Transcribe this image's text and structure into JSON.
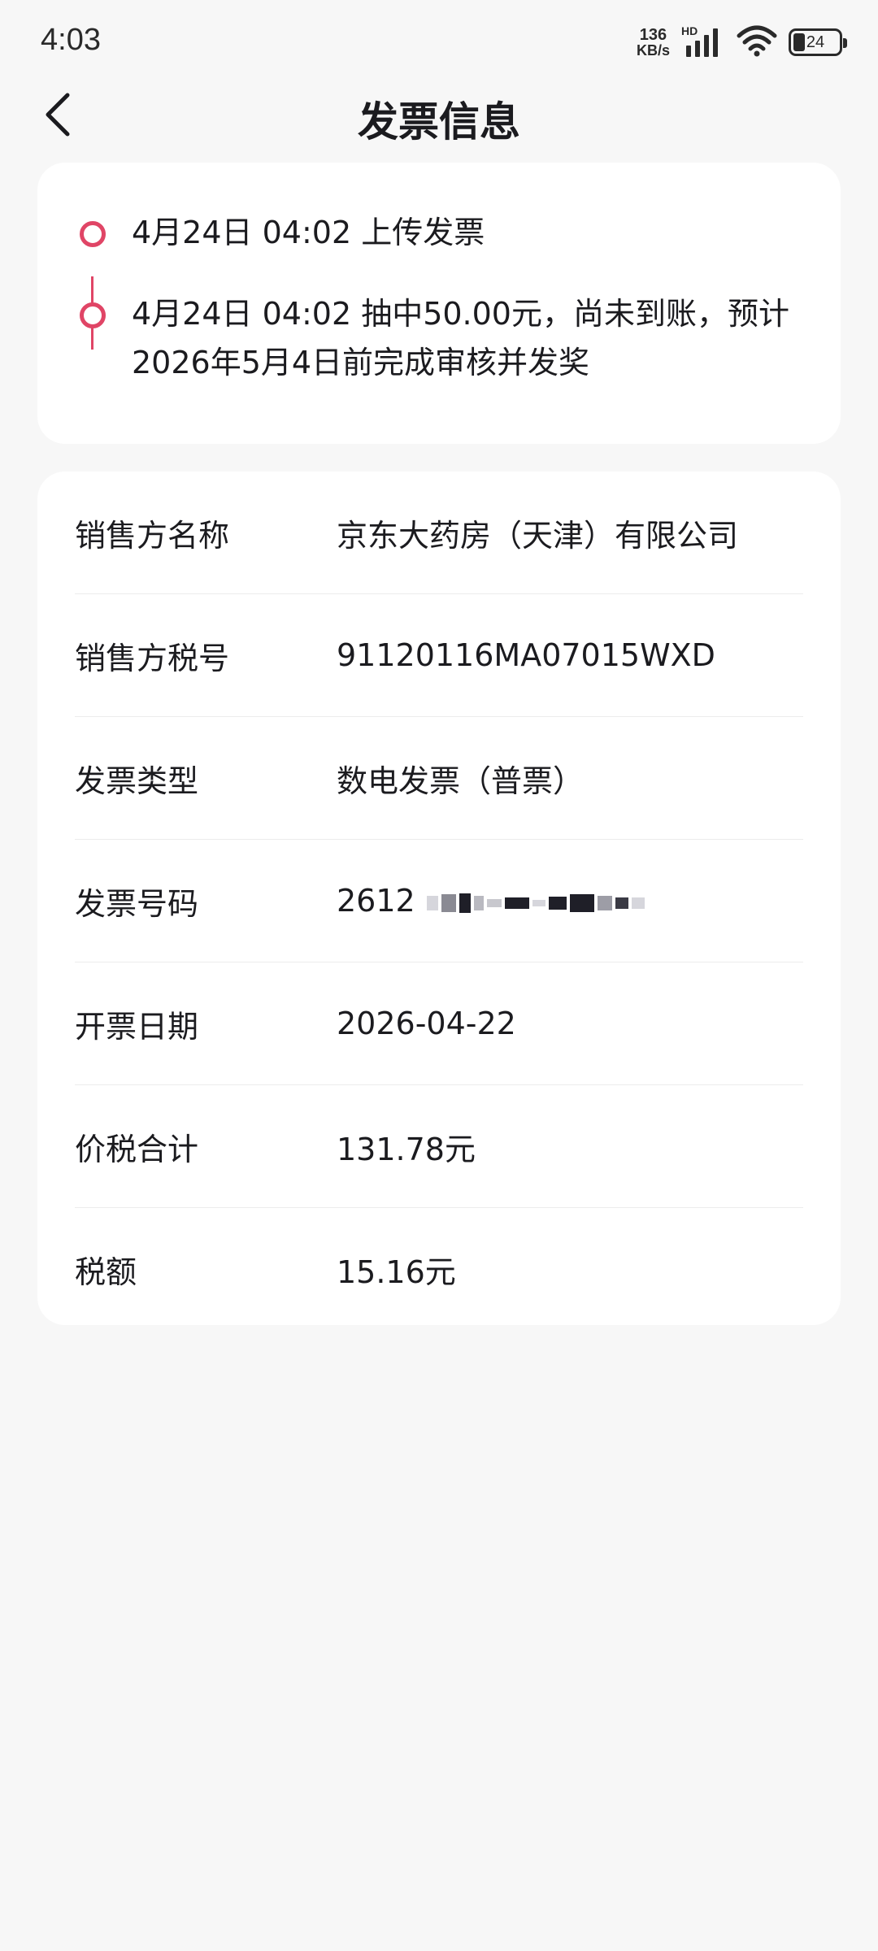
{
  "status": {
    "time": "4:03",
    "net_speed_value": "136",
    "net_speed_unit": "KB/s",
    "network_label": "HD",
    "battery": "24"
  },
  "header": {
    "title": "发票信息",
    "back_icon": "chevron-left-icon"
  },
  "timeline": [
    {
      "text": "4月24日 04:02 上传发票"
    },
    {
      "text": "4月24日 04:02 抽中50.00元，尚未到账，预计2026年5月4日前完成审核并发奖"
    }
  ],
  "details": {
    "rows": [
      {
        "label": "销售方名称",
        "value": "京东大药房（天津）有限公司"
      },
      {
        "label": "销售方税号",
        "value": "91120116MA07015WXD"
      },
      {
        "label": "发票类型",
        "value": "数电发票（普票）"
      },
      {
        "label": "发票号码",
        "value": "2612"
      },
      {
        "label": "开票日期",
        "value": "2026-04-22"
      },
      {
        "label": "价税合计",
        "value": "131.78元"
      },
      {
        "label": "税额",
        "value": "15.16元"
      }
    ]
  },
  "colors": {
    "accent": "#e04566",
    "background": "#f7f7f7",
    "card": "#ffffff",
    "text": "#1b1b1f"
  }
}
